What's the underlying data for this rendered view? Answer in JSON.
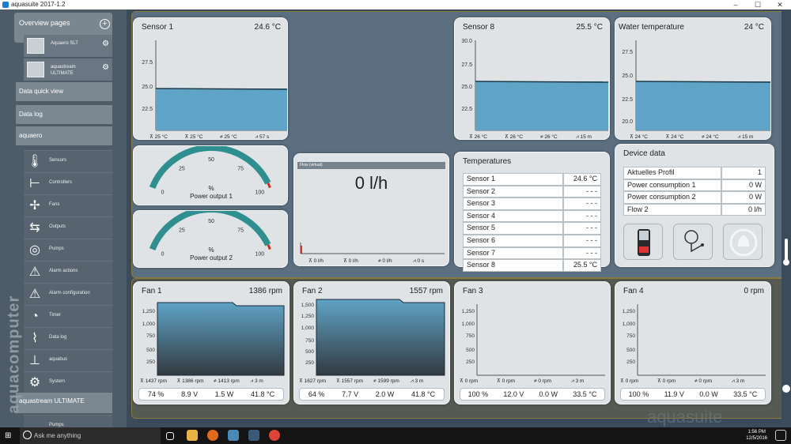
{
  "window": {
    "title": "aquasuite 2017-1.2",
    "minimize": "–",
    "maximize": "☐",
    "close": "✕"
  },
  "sidebar": {
    "overview_title": "Overview pages",
    "devices": [
      {
        "name": "Aquaero SLT"
      },
      {
        "name": "aquastream ULTIMATE"
      }
    ],
    "data_quick_view": "Data quick view",
    "data_log": "Data log",
    "aquaero": "aquaero",
    "items": [
      {
        "label": "Sensors",
        "icon": "thermometer-icon"
      },
      {
        "label": "Controllers",
        "icon": "controllers-icon"
      },
      {
        "label": "Fans",
        "icon": "fan-icon"
      },
      {
        "label": "Outputs",
        "icon": "outputs-icon"
      },
      {
        "label": "Pumps",
        "icon": "pump-icon"
      },
      {
        "label": "Alarm actions",
        "icon": "alarm-icon"
      },
      {
        "label": "Alarm configuration",
        "icon": "alarm-config-icon"
      },
      {
        "label": "Timer",
        "icon": "timer-icon"
      },
      {
        "label": "Data log",
        "icon": "datalog-icon"
      },
      {
        "label": "aquabus",
        "icon": "aquabus-icon"
      },
      {
        "label": "System",
        "icon": "gear-icon"
      }
    ],
    "aquastream": "aquastream ULTIMATE",
    "pumps_cut": "Pumps",
    "brand": "aquacomputer"
  },
  "sensors": [
    {
      "title": "Sensor 1",
      "value": "24.6 °C",
      "yticks": [
        "27.5",
        "25.0",
        "22.5"
      ],
      "foot": [
        "25 °C",
        "25 °C",
        "25 °C",
        "57 s"
      ]
    },
    {
      "title": "Sensor 8",
      "value": "25.5 °C",
      "yticks": [
        "30.0",
        "27.5",
        "25.0",
        "22.5"
      ],
      "foot": [
        "26 °C",
        "26 °C",
        "26 °C",
        "15 m"
      ]
    },
    {
      "title": "Water temperature",
      "value": "24 °C",
      "yticks": [
        "27.5",
        "25.0",
        "22.5",
        "20.0"
      ],
      "foot": [
        "24 °C",
        "24 °C",
        "24 °C",
        "15 m"
      ]
    }
  ],
  "gauges": [
    {
      "unit": "%",
      "label": "Power output 1",
      "ticks": [
        "0",
        "25",
        "50",
        "75",
        "100"
      ]
    },
    {
      "unit": "%",
      "label": "Power output 2",
      "ticks": [
        "0",
        "25",
        "50",
        "75",
        "100"
      ]
    }
  ],
  "flow": {
    "header": "Flow (virtual)",
    "value": "0 l/h",
    "foot": [
      "0 l/h",
      "0 l/h",
      "0 l/h",
      "0 s"
    ]
  },
  "temperatures": {
    "title": "Temperatures",
    "rows": [
      {
        "name": "Sensor 1",
        "value": "24.6 °C"
      },
      {
        "name": "Sensor 2",
        "value": "- - -"
      },
      {
        "name": "Sensor 3",
        "value": "- - -"
      },
      {
        "name": "Sensor 4",
        "value": "- - -"
      },
      {
        "name": "Sensor 5",
        "value": "- - -"
      },
      {
        "name": "Sensor 6",
        "value": "- - -"
      },
      {
        "name": "Sensor 7",
        "value": "- - -"
      },
      {
        "name": "Sensor 8",
        "value": "25.5 °C"
      }
    ]
  },
  "device_data": {
    "title": "Device data",
    "rows": [
      {
        "name": "Aktuelles Profil",
        "value": "1"
      },
      {
        "name": "Power consumption 1",
        "value": "0 W"
      },
      {
        "name": "Power consumption 2",
        "value": "0 W"
      },
      {
        "name": "Flow 2",
        "value": "0 l/h"
      }
    ]
  },
  "fans": [
    {
      "title": "Fan 1",
      "rpm": "1386 rpm",
      "yticks": [
        "1,250",
        "1,000",
        "750",
        "500",
        "250"
      ],
      "foot": [
        "1437 rpm",
        "1386 rpm",
        "1413 rpm",
        "3 m"
      ],
      "stats": [
        "74 %",
        "8.9 V",
        "1.5 W",
        "41.8 °C"
      ]
    },
    {
      "title": "Fan 2",
      "rpm": "1557 rpm",
      "yticks": [
        "1,500",
        "1,250",
        "1,000",
        "750",
        "500",
        "250"
      ],
      "foot": [
        "1627 rpm",
        "1557 rpm",
        "1599 rpm",
        "3 m"
      ],
      "stats": [
        "64 %",
        "7.7 V",
        "2.0 W",
        "41.8 °C"
      ]
    },
    {
      "title": "Fan 3",
      "rpm": "",
      "yticks": [
        "1,250",
        "1,000",
        "750",
        "500",
        "250"
      ],
      "foot": [
        "0 rpm",
        "0 rpm",
        "0 rpm",
        "3 m"
      ],
      "stats": [
        "100 %",
        "12.0 V",
        "0.0 W",
        "33.5 °C"
      ]
    },
    {
      "title": "Fan 4",
      "rpm": "0 rpm",
      "yticks": [
        "1,250",
        "1,000",
        "750",
        "500",
        "250"
      ],
      "foot": [
        "0 rpm",
        "0 rpm",
        "0 rpm",
        "3 m"
      ],
      "stats": [
        "100 %",
        "11.9 V",
        "0.0 W",
        "33.5 °C"
      ]
    }
  ],
  "watermark": "aquasuite",
  "taskbar": {
    "search": "Ask me anything",
    "time": "1:56 PM",
    "date": "12/5/2016"
  },
  "colors": {
    "chart_fill": "#5fa3c6",
    "gauge": "#2f8f8f",
    "gauge_red": "#d03020"
  }
}
